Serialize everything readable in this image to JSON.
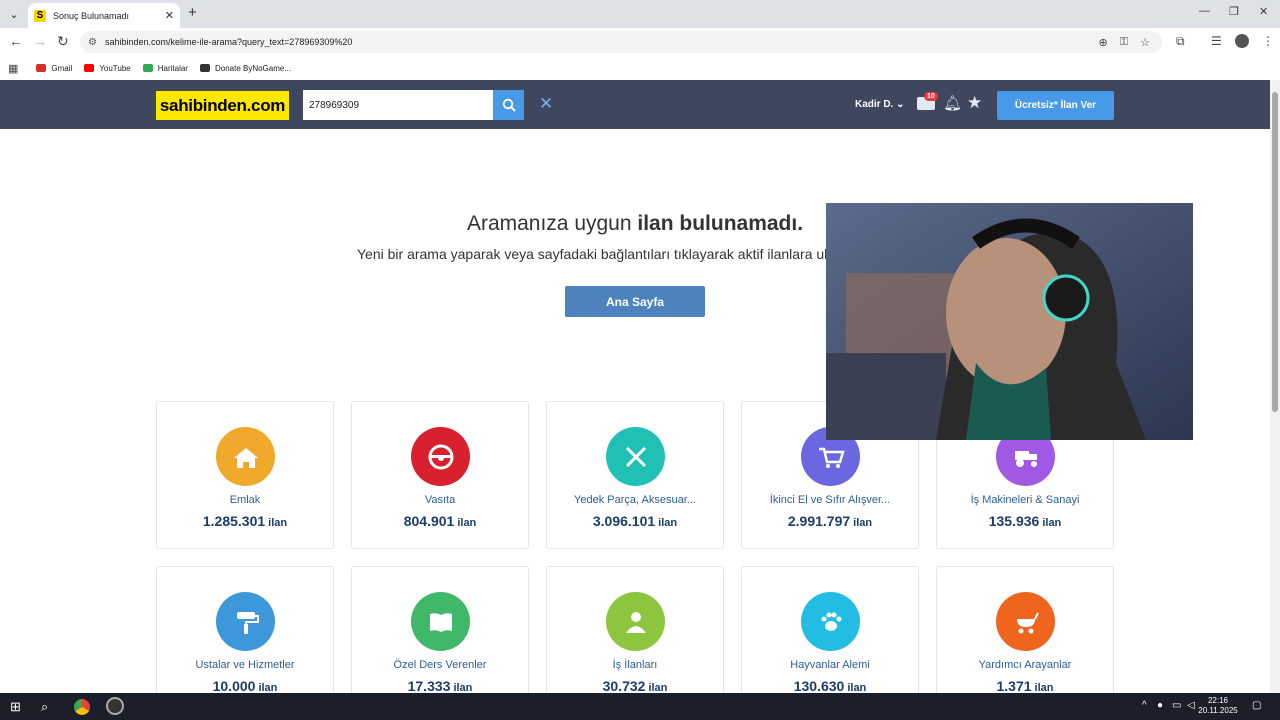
{
  "browser": {
    "tab_title": "Sonuç Bulunamadı",
    "favicon_letter": "S",
    "url": "sahibinden.com/kelime-ile-arama?query_text=278969309%20",
    "bookmarks": [
      {
        "label": "Gmail",
        "color": "#d93025"
      },
      {
        "label": "YouTube",
        "color": "#ff0000"
      },
      {
        "label": "Haritalar",
        "color": "#34a853"
      },
      {
        "label": "Donate ByNoGame...",
        "color": "#333333"
      }
    ]
  },
  "header": {
    "logo": "sahibinden.com",
    "search_value": "278969309",
    "user_name": "Kadir D.",
    "mail_count": "10",
    "post_button": "Ücretsiz* İlan Ver"
  },
  "main": {
    "heading_prefix": "Aramanıza uygun ",
    "heading_bold": "ilan bulunamadı.",
    "subheading": "Yeni bir arama yaparak veya sayfadaki bağlantıları tıklayarak aktif ilanlara ulaşabilirsiniz.",
    "home_button": "Ana Sayfa",
    "count_unit": "ilan",
    "categories": [
      {
        "name": "Emlak",
        "count": "1.285.301",
        "color": "#f0a92b",
        "icon": "house-icon"
      },
      {
        "name": "Vasıta",
        "count": "804.901",
        "color": "#d9202f",
        "icon": "steering-wheel-icon"
      },
      {
        "name": "Yedek Parça, Aksesuar...",
        "count": "3.096.101",
        "color": "#20c0b5",
        "icon": "tools-icon"
      },
      {
        "name": "İkinci El ve Sıfır Alışver...",
        "count": "2.991.797",
        "color": "#6a67e0",
        "icon": "cart-icon"
      },
      {
        "name": "İş Makineleri & Sanayi",
        "count": "135.936",
        "color": "#a158e4",
        "icon": "tractor-icon"
      },
      {
        "name": "Ustalar ve Hizmetler",
        "count": "10.000",
        "color": "#3e97d9",
        "icon": "paint-roller-icon"
      },
      {
        "name": "Özel Ders Verenler",
        "count": "17.333",
        "color": "#3fb86a",
        "icon": "book-icon"
      },
      {
        "name": "İş İlanları",
        "count": "30.732",
        "color": "#8cc63e",
        "icon": "person-icon"
      },
      {
        "name": "Hayvanlar Alemi",
        "count": "130.630",
        "color": "#23bde4",
        "icon": "paw-icon"
      },
      {
        "name": "Yardımcı Arayanlar",
        "count": "1.371",
        "color": "#f0651e",
        "icon": "stroller-icon"
      }
    ]
  },
  "taskbar": {
    "time": "22:16",
    "date": "20.11.2025"
  }
}
